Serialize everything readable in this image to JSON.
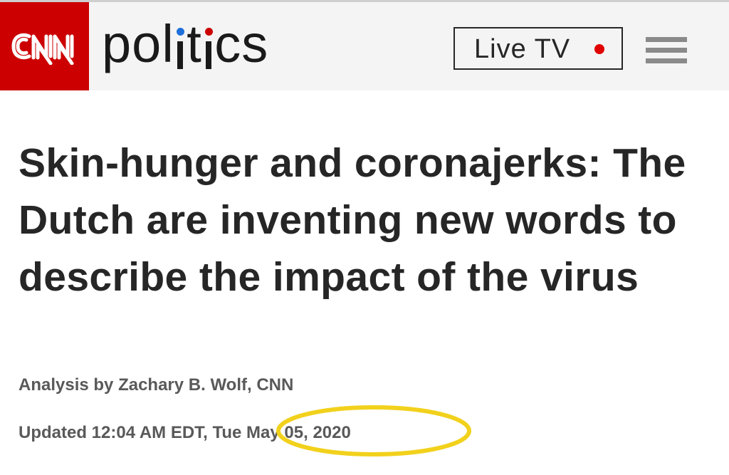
{
  "header": {
    "logo_text": "CNN",
    "section_title": "politics",
    "live_tv_label": "Live TV",
    "menu_icon": "hamburger-menu-icon"
  },
  "article": {
    "headline": "Skin-hunger and coronajerks: The Dutch are inventing new words to describe the impact of the virus",
    "byline": "Analysis by Zachary B. Wolf, CNN",
    "updated": "Updated 12:04 AM EDT, Tue May 05, 2020"
  },
  "colors": {
    "brand_red": "#cc0000",
    "live_dot": "#e00000",
    "accent_blue": "#1e6fd9",
    "highlight_yellow": "#f2d11c",
    "header_bg": "#f4f4f4",
    "headline_text": "#262626",
    "meta_text": "#595959"
  }
}
